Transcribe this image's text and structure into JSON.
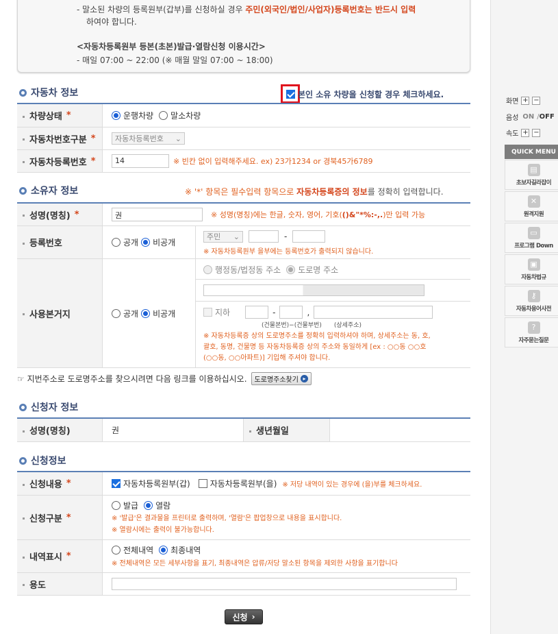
{
  "notice": {
    "line1_a": "- 말소된 차량의 등록원부(갑부)를 신청하실 경우 ",
    "line1_b": "주민(외국인/법인/사업자)등록번호는 반드시 입력",
    "line2": "하여야 합니다.",
    "hours_title": "<자동차등록원부 등본(초본)발급·열람신청 이용시간>",
    "hours_text": "- 매일 07:00 ~ 22:00 (※ 매월 말일 07:00 ~ 18:00)"
  },
  "vehicle": {
    "title": "자동차 정보",
    "own_check_label": "본인 소유 차량을 신청할 경우 체크하세요.",
    "own_checked": true,
    "status_label": "차량상태",
    "status_opt1": "운행차량",
    "status_opt2": "말소차량",
    "numtype_label": "자동차번호구분",
    "numtype_value": "자동차등록번호",
    "regno_label": "자동차등록번호",
    "regno_value": "14",
    "regno_hint": "※ 빈칸 없이 입력해주세요. ex) 23가1234 or 경북45가6789"
  },
  "owner": {
    "title": "소유자 정보",
    "req_note_a": "※ '*' 항목은 필수입력 항목으로 ",
    "req_note_b": "자동차등록증의 정보",
    "req_note_c": "를 정확히 입력합니다.",
    "name_label": "성명(명칭)",
    "name_value": "권",
    "name_hint_a": "※ 성명(명칭)에는 한글, 숫자, 영어, 기호(",
    "name_hint_b": "()&\"*%:-,.",
    "name_hint_c": ")만 입력 가능",
    "regnum_label": "등록번호",
    "public_label": "공개",
    "private_label": "비공개",
    "idtype_value": "주민",
    "idsep": "-",
    "regnum_note": "※ 자동차등록원부 을부에는 등록번호가 출력되지 않습니다.",
    "addr_label": "사용본거지",
    "addr_opt1": "행정동/법정동 주소",
    "addr_opt2": "도로명 주소",
    "basement_label": "지하",
    "addr_comma": ",",
    "bldg_main_cap": "(건물본번)",
    "bldg_sub_cap": "(건물부번)",
    "detail_cap": "(상세주소)",
    "addr_note1": "※ 자동차등록증 상의 도로명주소를 정확히 입력하셔야 하며, 상세주소는 동, 호,",
    "addr_note2": "괄호, 동명, 건물명 등 자동차등록증 상의 주소와 동일하게 [ex : ○○동 ○○호",
    "addr_note3": "(○○동, ○○아파트)] 기입해 주셔야 합니다.",
    "road_link_text": "☞ 지번주소로 도로명주소를 찾으시려면 다음 링크를 이용하십시오.",
    "road_btn": "도로명주소찾기"
  },
  "applicant": {
    "title": "신청자 정보",
    "name_label": "성명(명칭)",
    "name_value": "권",
    "birth_label": "생년월일"
  },
  "request": {
    "title": "신청정보",
    "content_label": "신청내용",
    "content_opt1": "자동차등록원부(갑)",
    "content_opt2": "자동차등록원부(을)",
    "content_note": "※ 저당 내역이 있는 경우에 (을)부를 체크하세요.",
    "type_label": "신청구분",
    "type_opt1": "발급",
    "type_opt2": "열람",
    "type_note1": "※ '발급'은 결과물을 프린터로 출력하며, '열람'은 팝업창으로 내용을 표시합니다.",
    "type_note2": "※ 열람시에는 출력이 불가능합니다.",
    "history_label": "내역표시",
    "history_opt1": "전체내역",
    "history_opt2": "최종내역",
    "history_note": "※ 전체내역은 모든 세부사항을 표기, 최종내역은 압류/저당 말소된 항목을 제외한 사항을 표기합니다",
    "purpose_label": "용도",
    "submit": "신청"
  },
  "sidebar": {
    "screen_label": "화면",
    "voice_label": "음성",
    "voice_on": "ON",
    "voice_sep": "/",
    "voice_off": "OFF",
    "speed_label": "속도",
    "plus": "+",
    "minus": "−",
    "quick_menu": "QUICK MENU",
    "items": [
      "초보자길라잡이",
      "원격지원",
      "프로그램 Down",
      "자동차법규",
      "자동차용어사전",
      "자주묻는질문"
    ]
  },
  "accent_color": "#5a7fb5",
  "highlight_color": "#e0601f"
}
